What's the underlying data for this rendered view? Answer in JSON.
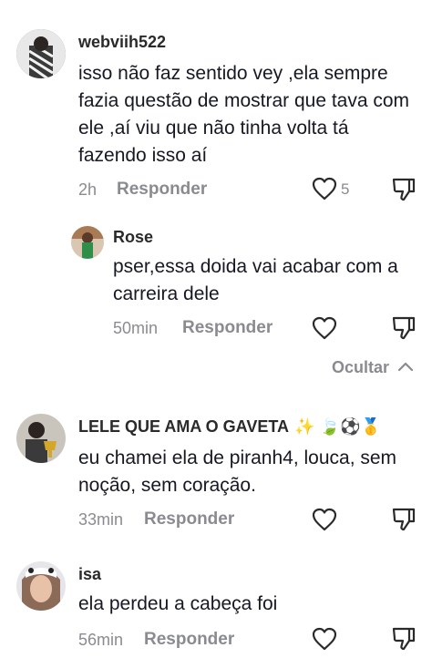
{
  "comments": [
    {
      "username": "webviih522",
      "text": "isso não faz sentido vey ,ela sempre fazia questão de mostrar que tava com ele ,aí viu que não tinha volta tá fazendo isso aí",
      "time": "2h",
      "reply_label": "Responder",
      "likes": "5"
    },
    {
      "username": "Rose",
      "text": "pser,essa doida vai acabar com a carreira dele",
      "time": "50min",
      "reply_label": "Responder"
    },
    {
      "username": "LELE QUE AMA O GAVETA",
      "emojis": "✨ 🍃⚽🥇",
      "text": "eu chamei ela de piranh4, louca, sem noção, sem coração.",
      "time": "33min",
      "reply_label": "Responder"
    },
    {
      "username": "isa",
      "text": "ela perdeu a cabeça foi",
      "time": "56min",
      "reply_label": "Responder"
    }
  ],
  "hide_replies_label": "Ocultar",
  "icons": {
    "like": "heart-outline-icon",
    "dislike": "thumbs-down-outline-icon",
    "hide": "chevron-up-icon"
  },
  "colors": {
    "text": "#161823",
    "muted": "#8a8b91"
  }
}
